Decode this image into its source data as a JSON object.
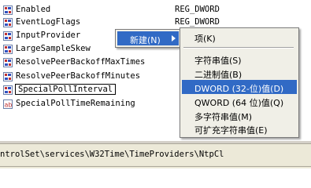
{
  "registry": {
    "values": [
      {
        "name": "Enabled",
        "type": "REG_DWORD",
        "icon": "reg-binary-icon"
      },
      {
        "name": "EventLogFlags",
        "type": "REG_DWORD",
        "icon": "reg-binary-icon"
      },
      {
        "name": "InputProvider",
        "type": "",
        "icon": "reg-binary-icon"
      },
      {
        "name": "LargeSampleSkew",
        "type": "",
        "icon": "reg-binary-icon"
      },
      {
        "name": "ResolvePeerBackoffMaxTimes",
        "type": "",
        "icon": "reg-binary-icon"
      },
      {
        "name": "ResolvePeerBackoffMinutes",
        "type": "",
        "icon": "reg-binary-icon"
      },
      {
        "name": "SpecialPollInterval",
        "type": "",
        "icon": "reg-binary-icon"
      },
      {
        "name": "SpecialPollTimeRemaining",
        "type": "",
        "icon": "reg-string-icon"
      }
    ]
  },
  "statusbar": {
    "path": "ntrolSet\\services\\W32Time\\TimeProviders\\NtpCl"
  },
  "context_menu": {
    "new_label": "新建(N)"
  },
  "submenu": {
    "items": [
      {
        "label": "项(K)"
      },
      {
        "label": "字符串值(S)"
      },
      {
        "label": "二进制值(B)"
      },
      {
        "label": "DWORD (32-位)值(D)"
      },
      {
        "label": "QWORD (64 位)值(Q)"
      },
      {
        "label": "多字符串值(M)"
      },
      {
        "label": "可扩充字符串值(E)"
      }
    ]
  }
}
